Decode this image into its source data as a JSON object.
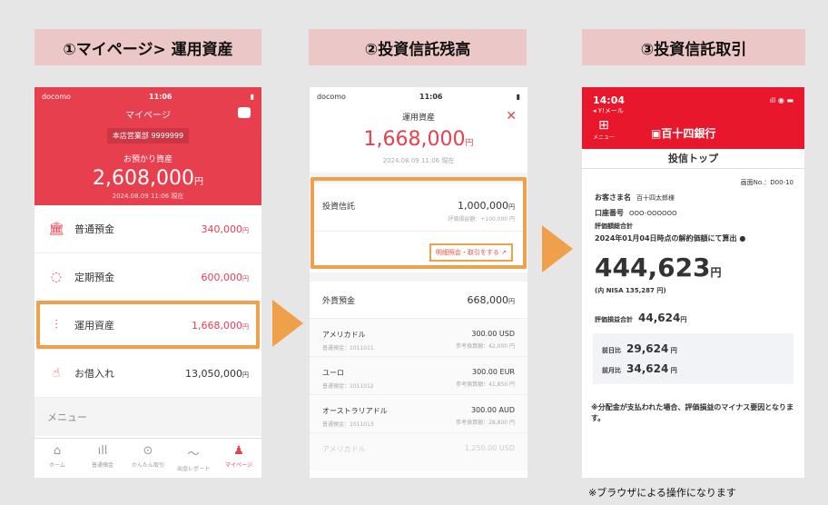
{
  "steps": [
    "①マイページ> 運用資産",
    "②投資信託残高",
    "③投資信託取引"
  ],
  "footnote": "※ブラウザによる操作になります",
  "phone1": {
    "status": {
      "carrier": "docomo",
      "time": "11:06"
    },
    "title": "マイページ",
    "branch": "本店営業部 9999999",
    "deposit_label": "お預かり資産",
    "deposit_amount": "2,608,000",
    "yen": "円",
    "as_of": "2024.08.09 11:06 現在",
    "rows": [
      {
        "icon": "bank-icon",
        "glyph": "🏛",
        "label": "普通預金",
        "value": "340,000"
      },
      {
        "icon": "piggy-bank-icon",
        "glyph": "◌",
        "label": "定期預金",
        "value": "600,000"
      },
      {
        "icon": "investment-icon",
        "glyph": "⫶",
        "label": "運用資産",
        "value": "1,668,000"
      },
      {
        "icon": "loan-icon",
        "glyph": "☝",
        "label": "お借入れ",
        "value": "13,050,000"
      }
    ],
    "menu_label": "メニュー",
    "tabs": [
      {
        "icon": "home-icon",
        "glyph": "⌂",
        "label": "ホーム"
      },
      {
        "icon": "savings-chart-icon",
        "glyph": "ıll",
        "label": "普通預金"
      },
      {
        "icon": "transfer-icon",
        "glyph": "⊙",
        "label": "かんたん取引"
      },
      {
        "icon": "report-icon",
        "glyph": "〜",
        "label": "出金レポート"
      },
      {
        "icon": "mypage-icon",
        "glyph": "♟",
        "label": "マイページ"
      }
    ]
  },
  "phone2": {
    "status": {
      "carrier": "docomo",
      "time": "11:06"
    },
    "title": "運用資産",
    "total": "1,668,000",
    "yen": "円",
    "as_of": "2024.08.09 11:06 現在",
    "investment_label": "投資信託",
    "investment_amount": "1,000,000",
    "investment_sub": "評価損益額：+100,000 円",
    "link_label": "明細照会・取引をする",
    "fx_label": "外貨預金",
    "fx_amount": "668,000",
    "currencies": [
      {
        "name": "アメリカドル",
        "acct": "普通預金：1011011",
        "amount": "300.00 USD",
        "ref": "参考換算額：42,000 円"
      },
      {
        "name": "ユーロ",
        "acct": "普通預金：1011012",
        "amount": "300.00 EUR",
        "ref": "参考換算額：41,850 円"
      },
      {
        "name": "オーストラリアドル",
        "acct": "普通預金：1011013",
        "amount": "300.00 AUD",
        "ref": "参考換算額：28,800 円"
      },
      {
        "name": "アメリカドル",
        "acct": "",
        "amount": "1,250.00 USD",
        "ref": ""
      }
    ]
  },
  "phone3": {
    "status": {
      "time": "14:04",
      "back": "◂ Y!メール"
    },
    "menu_label": "メニュー",
    "bank_name": "百十四銀行",
    "page_title": "投信トップ",
    "page_no": "画面No.：D00-10",
    "customer_label": "お客さま名",
    "customer_name": "百十四太郎様",
    "account_label": "口座番号",
    "account_no": "OOO-OOOOOO",
    "eval_label": "評価額総合計",
    "eval_note": "2024年01月04日時点の解約価額にて算出",
    "eval_amount": "444,623",
    "yen": "円",
    "nisa": "(内 NISA 135,287 円)",
    "pl_label": "評価損益合計",
    "pl_amount": "44,624",
    "day_label": "前日比",
    "day_amount": "29,624",
    "month_label": "前月比",
    "month_amount": "34,624",
    "note": "※分配金が支払われた場合、評価損益のマイナス要因となります。"
  }
}
